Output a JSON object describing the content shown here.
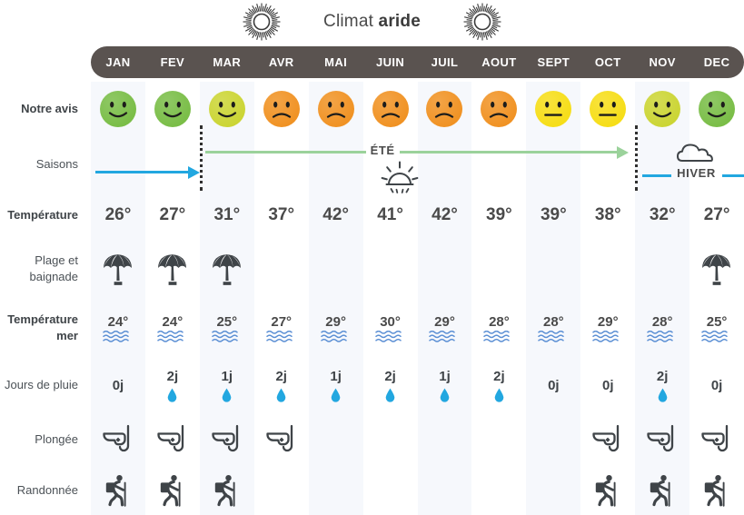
{
  "title": {
    "prefix": "Climat ",
    "emphasis": "aride",
    "left_icon": "sun-icon",
    "right_icon": "sun-icon"
  },
  "months": [
    "JAN",
    "FEV",
    "MAR",
    "AVR",
    "MAI",
    "JUIN",
    "JUIL",
    "AOUT",
    "SEPT",
    "OCT",
    "NOV",
    "DEC"
  ],
  "rows": {
    "avis": {
      "label": "Notre avis"
    },
    "saisons": {
      "label": "Saisons"
    },
    "temperature": {
      "label": "Température"
    },
    "plage": {
      "label": "Plage et baignade"
    },
    "mer": {
      "label": "Température mer"
    },
    "pluie": {
      "label": "Jours de pluie"
    },
    "plongee": {
      "label": "Plongée"
    },
    "randonnee": {
      "label": "Randonnée"
    }
  },
  "seasons": {
    "summer_label": "ÉTÉ",
    "summer_icon": "sun-icon",
    "winter_label": "HIVER",
    "winter_icon": "cloud-icon",
    "early_winter_color": "#22a7e0",
    "summer_color": "#9bd29b",
    "winter_color": "#22a7e0"
  },
  "colors": {
    "header_bar": "#5a5350",
    "band": "#f6f8fc",
    "text": "#4a4a4a",
    "blue": "#22a7e0",
    "green": "#9bd29b",
    "wave": "#5b8fd4",
    "icon_dark": "#3f4448",
    "smiley_green": "#77bc43",
    "smiley_yellowgreen": "#cad430",
    "smiley_yellow": "#f6dd12",
    "smiley_orange": "#f0901f"
  },
  "chart_data": {
    "type": "table",
    "title": "Climat aride",
    "categories": [
      "JAN",
      "FEV",
      "MAR",
      "AVR",
      "MAI",
      "JUIN",
      "JUIL",
      "AOUT",
      "SEPT",
      "OCT",
      "NOV",
      "DEC"
    ],
    "series": [
      {
        "name": "Notre avis",
        "values": [
          "smile-green",
          "smile-green",
          "smile-yellowgreen",
          "frown-orange",
          "frown-orange",
          "frown-orange",
          "frown-orange",
          "frown-orange",
          "neutral-yellow",
          "neutral-yellow",
          "smile-yellowgreen",
          "smile-green"
        ]
      },
      {
        "name": "Température",
        "unit": "°",
        "values": [
          26,
          27,
          31,
          37,
          42,
          41,
          42,
          39,
          39,
          38,
          32,
          27
        ]
      },
      {
        "name": "Plage et baignade",
        "values": [
          true,
          true,
          true,
          false,
          false,
          false,
          false,
          false,
          false,
          false,
          false,
          true
        ]
      },
      {
        "name": "Température mer",
        "unit": "°",
        "values": [
          24,
          24,
          25,
          27,
          29,
          30,
          29,
          28,
          28,
          29,
          28,
          25
        ]
      },
      {
        "name": "Jours de pluie",
        "unit": "j",
        "values": [
          0,
          2,
          1,
          2,
          1,
          2,
          1,
          2,
          0,
          0,
          2,
          0
        ]
      },
      {
        "name": "Plongée",
        "values": [
          true,
          true,
          true,
          true,
          false,
          false,
          false,
          false,
          false,
          true,
          true,
          true
        ]
      },
      {
        "name": "Randonnée",
        "values": [
          true,
          true,
          true,
          false,
          false,
          false,
          false,
          false,
          false,
          true,
          true,
          true
        ]
      }
    ],
    "seasons": [
      {
        "name": "HIVER (début)",
        "from": "JAN",
        "to": "FEV",
        "color": "#22a7e0"
      },
      {
        "name": "ÉTÉ",
        "from": "MAR",
        "to": "OCT",
        "color": "#9bd29b"
      },
      {
        "name": "HIVER",
        "from": "NOV",
        "to": "DEC",
        "color": "#22a7e0"
      }
    ]
  },
  "display": {
    "temperature_text": [
      "26°",
      "27°",
      "31°",
      "37°",
      "42°",
      "41°",
      "42°",
      "39°",
      "39°",
      "38°",
      "32°",
      "27°"
    ],
    "sea_text": [
      "24°",
      "24°",
      "25°",
      "27°",
      "29°",
      "30°",
      "29°",
      "28°",
      "28°",
      "29°",
      "28°",
      "25°"
    ],
    "rain_text": [
      "0j",
      "2j",
      "1j",
      "2j",
      "1j",
      "2j",
      "1j",
      "2j",
      "0j",
      "0j",
      "2j",
      "0j"
    ]
  }
}
